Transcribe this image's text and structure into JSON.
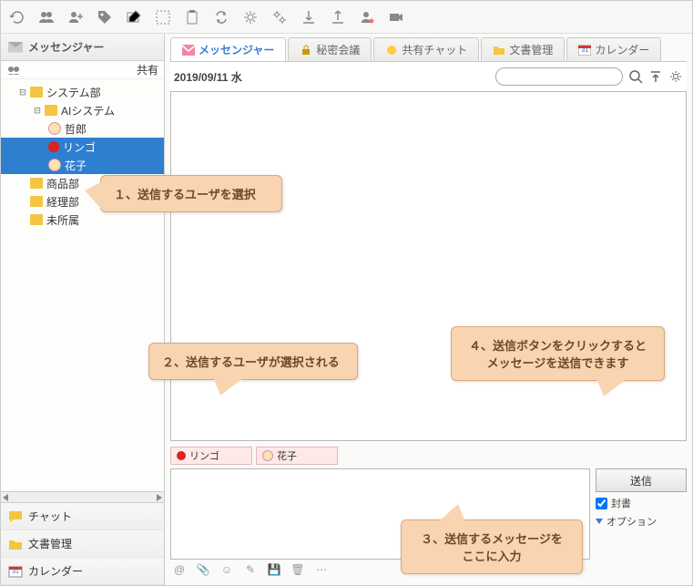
{
  "toolbar_icons": [
    "refresh",
    "group",
    "person-add",
    "tag",
    "compose",
    "select",
    "clipboard",
    "sync",
    "gear-single",
    "gear-double",
    "import",
    "export",
    "user-dot",
    "camera"
  ],
  "sidebar": {
    "title": "メッセンジャー",
    "share_label": "共有",
    "tree": {
      "n0": "システム部",
      "n1": "AIシステム",
      "n2": "哲郎",
      "n3": "リンゴ",
      "n4": "花子",
      "n5": "商品部",
      "n6": "経理部",
      "n7": "未所属"
    },
    "foot": {
      "chat": "チャット",
      "docs": "文書管理",
      "cal": "カレンダー",
      "cal_day": "31"
    }
  },
  "tabs": {
    "msg": "メッセンジャー",
    "secret": "秘密会議",
    "share": "共有チャット",
    "docs": "文書管理",
    "cal": "カレンダー",
    "cal_day": "31"
  },
  "date": "2019/09/11 水",
  "search_placeholder": "",
  "recipients": {
    "r0": "リンゴ",
    "r1": "花子"
  },
  "send": {
    "button": "送信",
    "sealed": "封書",
    "option": "オプション"
  },
  "callouts": {
    "c1": "１、送信するユーザを選択",
    "c2": "２、送信するユーザが選択される",
    "c3a": "３、送信するメッセージを",
    "c3b": "ここに入力",
    "c4a": "４、送信ボタンをクリックすると",
    "c4b": "メッセージを送信できます"
  }
}
